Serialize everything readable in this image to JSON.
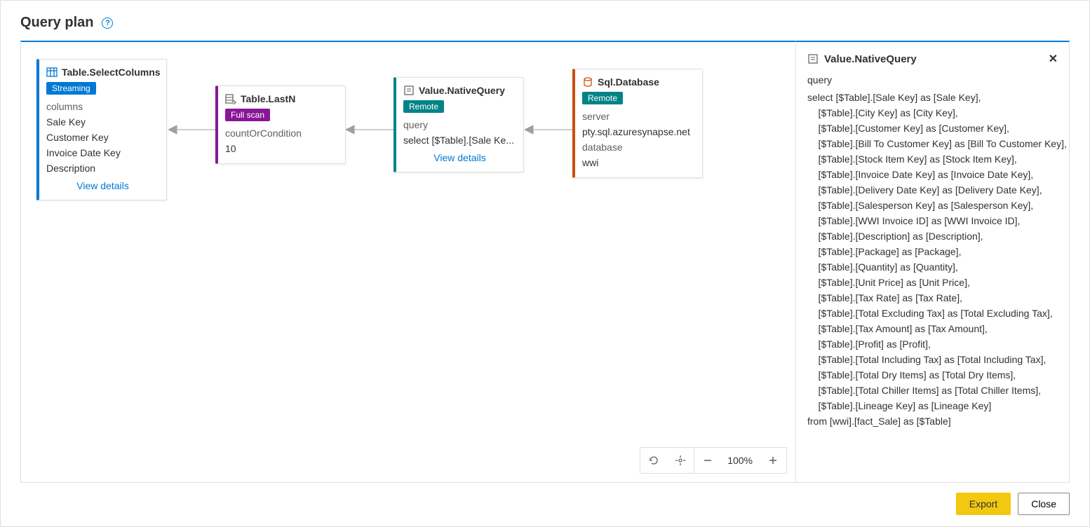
{
  "header": {
    "title": "Query plan"
  },
  "nodes": {
    "n1": {
      "title": "Table.SelectColumns",
      "badge": "Streaming",
      "label1": "columns",
      "row1": "Sale Key",
      "row2": "Customer Key",
      "row3": "Invoice Date Key",
      "row4": "Description",
      "view": "View details"
    },
    "n2": {
      "title": "Table.LastN",
      "badge": "Full scan",
      "label1": "countOrCondition",
      "row1": "10"
    },
    "n3": {
      "title": "Value.NativeQuery",
      "badge": "Remote",
      "label1": "query",
      "row1": "select [$Table].[Sale Ke...",
      "view": "View details"
    },
    "n4": {
      "title": "Sql.Database",
      "badge": "Remote",
      "label1": "server",
      "row1": "pty.sql.azuresynapse.net",
      "label2": "database",
      "row2": "wwi"
    }
  },
  "zoom": {
    "level": "100%"
  },
  "panel": {
    "title": "Value.NativeQuery",
    "label": "query",
    "sql": "select [$Table].[Sale Key] as [Sale Key],\n    [$Table].[City Key] as [City Key],\n    [$Table].[Customer Key] as [Customer Key],\n    [$Table].[Bill To Customer Key] as [Bill To Customer Key],\n    [$Table].[Stock Item Key] as [Stock Item Key],\n    [$Table].[Invoice Date Key] as [Invoice Date Key],\n    [$Table].[Delivery Date Key] as [Delivery Date Key],\n    [$Table].[Salesperson Key] as [Salesperson Key],\n    [$Table].[WWI Invoice ID] as [WWI Invoice ID],\n    [$Table].[Description] as [Description],\n    [$Table].[Package] as [Package],\n    [$Table].[Quantity] as [Quantity],\n    [$Table].[Unit Price] as [Unit Price],\n    [$Table].[Tax Rate] as [Tax Rate],\n    [$Table].[Total Excluding Tax] as [Total Excluding Tax],\n    [$Table].[Tax Amount] as [Tax Amount],\n    [$Table].[Profit] as [Profit],\n    [$Table].[Total Including Tax] as [Total Including Tax],\n    [$Table].[Total Dry Items] as [Total Dry Items],\n    [$Table].[Total Chiller Items] as [Total Chiller Items],\n    [$Table].[Lineage Key] as [Lineage Key]\nfrom [wwi].[fact_Sale] as [$Table]"
  },
  "footer": {
    "export": "Export",
    "close": "Close"
  }
}
